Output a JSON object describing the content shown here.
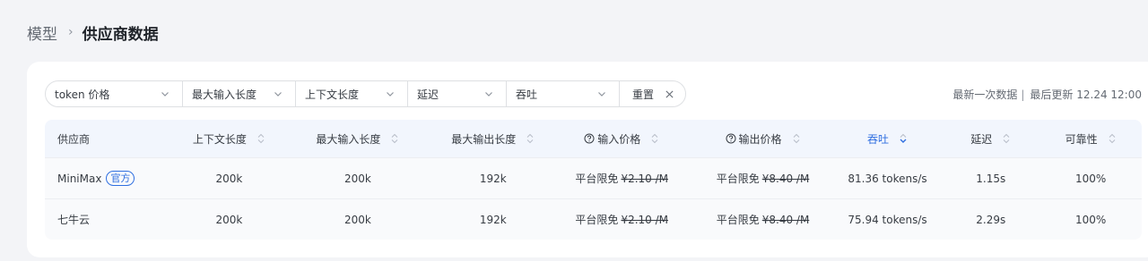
{
  "breadcrumb": {
    "parent": "模型",
    "separator": "›",
    "current": "供应商数据"
  },
  "filters": [
    {
      "label": "token 价格"
    },
    {
      "label": "最大输入长度"
    },
    {
      "label": "上下文长度"
    },
    {
      "label": "延迟"
    },
    {
      "label": "吞吐"
    }
  ],
  "reset_label": "重置",
  "meta": {
    "latest": "最新一次数据",
    "separator": "|",
    "updated": "最后更新 12.24 12:00"
  },
  "columns": [
    {
      "label": "供应商",
      "sortable": false
    },
    {
      "label": "上下文长度",
      "sortable": true
    },
    {
      "label": "最大输入长度",
      "sortable": true
    },
    {
      "label": "最大输出长度",
      "sortable": true
    },
    {
      "label": "输入价格",
      "sortable": true,
      "help": true
    },
    {
      "label": "输出价格",
      "sortable": true,
      "help": true
    },
    {
      "label": "吞吐",
      "sortable": true,
      "active": true,
      "direction": "desc"
    },
    {
      "label": "延迟",
      "sortable": true
    },
    {
      "label": "可靠性",
      "sortable": true
    }
  ],
  "rows": [
    {
      "provider": "MiniMax",
      "badge": "官方",
      "context": "200k",
      "max_input": "200k",
      "max_output": "192k",
      "input_price_label": "平台限免",
      "input_price_original": "¥2.10 /M",
      "output_price_label": "平台限免",
      "output_price_original": "¥8.40 /M",
      "throughput": "81.36 tokens/s",
      "latency": "1.15s",
      "reliability": "100%"
    },
    {
      "provider": "七牛云",
      "badge": "",
      "context": "200k",
      "max_input": "200k",
      "max_output": "192k",
      "input_price_label": "平台限免",
      "input_price_original": "¥2.10 /M",
      "output_price_label": "平台限免",
      "output_price_original": "¥8.40 /M",
      "throughput": "75.94 tokens/s",
      "latency": "2.29s",
      "reliability": "100%"
    }
  ],
  "colors": {
    "accent": "#2f6fe0",
    "header_bg": "#f2f6fd",
    "row_bg": "#f9fafc",
    "page_bg": "#f3f4f7"
  }
}
